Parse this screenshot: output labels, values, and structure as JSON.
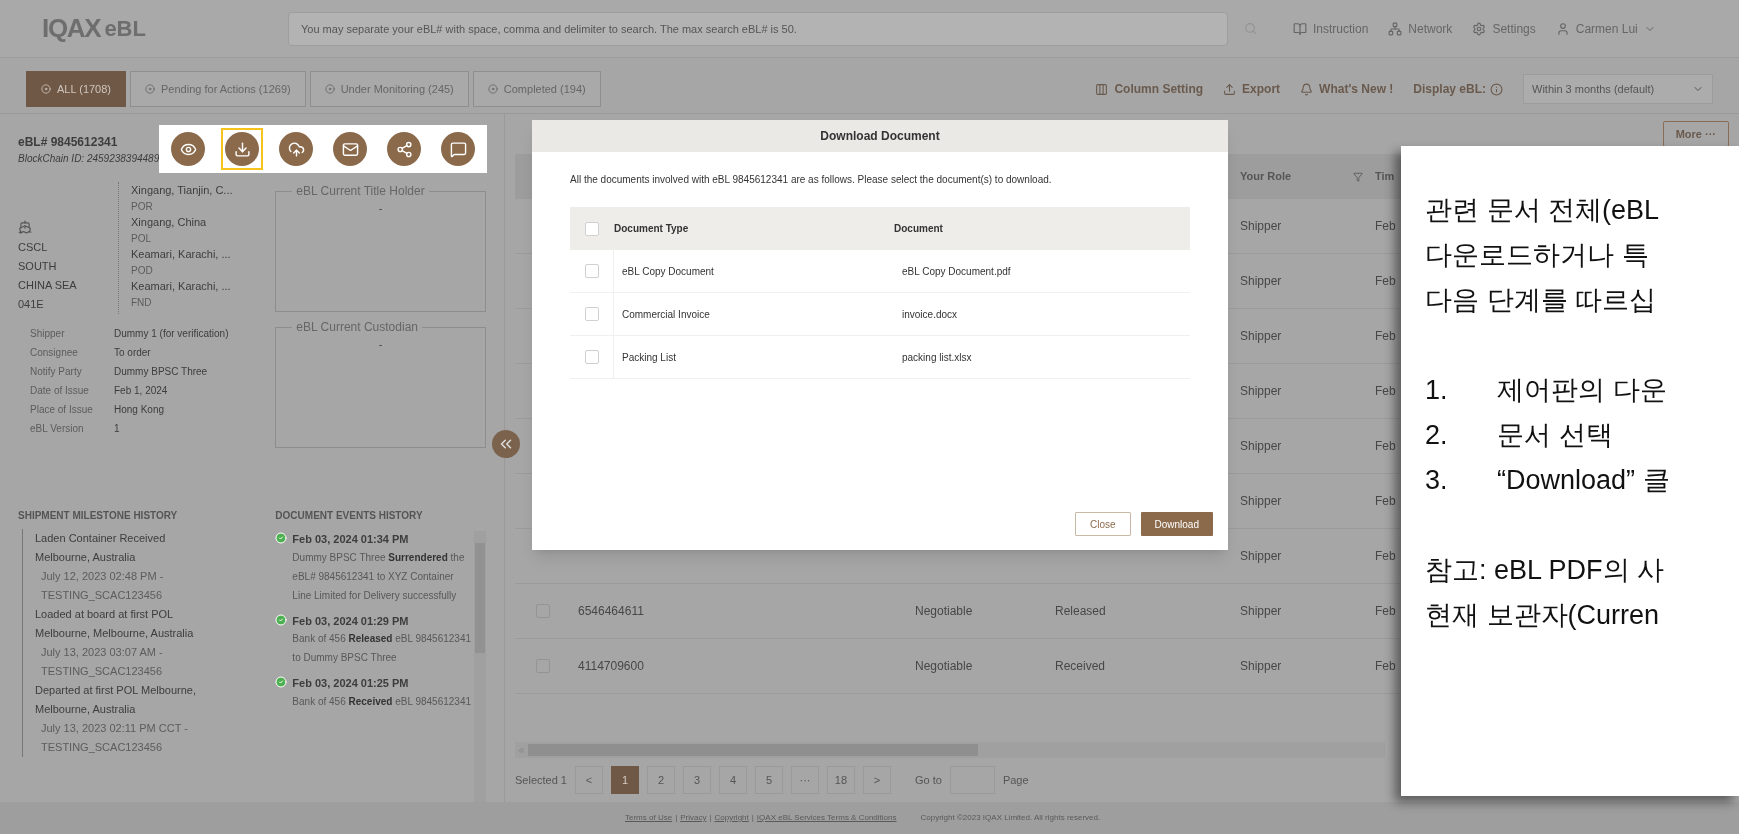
{
  "header": {
    "logo": "IQAX",
    "logo_suffix": "eBL",
    "search": {
      "placeholder": "You may separate your eBL# with space, comma and delimiter to search. The max search eBL# is 50."
    },
    "nav": [
      {
        "kind": "instruction",
        "label": "Instruction"
      },
      {
        "kind": "network",
        "label": "Network"
      },
      {
        "kind": "settings",
        "label": "Settings"
      },
      {
        "kind": "user",
        "label": "Carmen Lui"
      }
    ]
  },
  "tabs": [
    {
      "label": "ALL (1708)",
      "selected": true
    },
    {
      "label": "Pending for Actions (1269)",
      "selected": false
    },
    {
      "label": "Under Monitoring (245)",
      "selected": false
    },
    {
      "label": "Completed (194)",
      "selected": false
    }
  ],
  "tools": [
    {
      "kind": "columns",
      "label": "Column Setting"
    },
    {
      "kind": "export",
      "label": "Export"
    },
    {
      "kind": "news",
      "label": "What's New !"
    }
  ],
  "display": {
    "label": "Display eBL:",
    "value": "Within 3 months (default)"
  },
  "detail": {
    "ebl": "eBL# 9845612341",
    "blockchain": "BlockChain ID: 2459238394489",
    "actions": [
      {
        "kind": "view",
        "highlighted": false
      },
      {
        "kind": "download",
        "highlighted": true
      },
      {
        "kind": "upload",
        "highlighted": false
      },
      {
        "kind": "mail",
        "highlighted": false
      },
      {
        "kind": "share",
        "highlighted": false
      },
      {
        "kind": "comment",
        "highlighted": false
      }
    ],
    "vessel": "CSCL SOUTH CHINA SEA 041E",
    "route": [
      {
        "place": "Xingang, Tianjin, C...",
        "code": "POR"
      },
      {
        "place": "Xingang, China",
        "code": "POL"
      },
      {
        "place": "Keamari, Karachi, ...",
        "code": "POD"
      },
      {
        "place": "Keamari, Karachi, ...",
        "code": "FND"
      }
    ],
    "parties": [
      {
        "label": "Shipper",
        "value": "Dummy 1 (for verification)"
      },
      {
        "label": "Consignee",
        "value": "To order"
      },
      {
        "label": "Notify Party",
        "value": "Dummy BPSC Three"
      },
      {
        "label": "Date of Issue",
        "value": "Feb 1, 2024"
      },
      {
        "label": "Place of Issue",
        "value": "Hong Kong"
      },
      {
        "label": "eBL Version",
        "value": "1"
      }
    ],
    "title_holder": {
      "legend": "eBL Current Title Holder",
      "value": "-"
    },
    "custodian": {
      "legend": "eBL Current Custodian",
      "value": "-"
    },
    "milestones": {
      "title": "SHIPMENT MILESTONE HISTORY",
      "items": [
        {
          "event": "Laden Container Received",
          "location": "Melbourne, Australia",
          "time": "July 12, 2023 02:48 PM - TESTING_SCAC123456"
        },
        {
          "event": "Loaded at board at first POL",
          "location": "Melbourne, Melbourne, Australia",
          "time": "July 13, 2023 03:07 AM - TESTING_SCAC123456"
        },
        {
          "event": "Departed at first POL Melbourne,",
          "location": "Melbourne, Australia",
          "time": "July 13, 2023 02:11 PM CCT - TESTING_SCAC123456"
        }
      ]
    },
    "events": {
      "title": "DOCUMENT EVENTS HISTORY",
      "items": [
        {
          "time": "Feb 03, 2024 01:34 PM",
          "text": "Dummy BPSC Three **Surrendered** the eBL# 9845612341 to XYZ Container Line Limited for Delivery successfully"
        },
        {
          "time": "Feb 03, 2024 01:29 PM",
          "text": "Bank of 456 **Released** eBL 9845612341 to Dummy BPSC Three"
        },
        {
          "time": "Feb 03, 2024 01:25 PM",
          "text": "Bank of 456 **Received** eBL 9845612341"
        }
      ]
    }
  },
  "table": {
    "more": "More ···",
    "columns": [
      {
        "label": "Your Role",
        "filter": true
      },
      {
        "label": "Tim",
        "filter": false
      }
    ],
    "rows": [
      {
        "role": "Shipper",
        "time": "Feb"
      },
      {
        "role": "Shipper",
        "time": "Feb"
      },
      {
        "role": "Shipper",
        "time": "Feb"
      },
      {
        "role": "Shipper",
        "time": "Feb"
      },
      {
        "role": "Shipper",
        "time": "Feb"
      },
      {
        "role": "Shipper",
        "time": "Feb"
      },
      {
        "role": "Shipper",
        "time": "Feb"
      },
      {
        "checked": false,
        "ebl": "6546464611",
        "type": "Negotiable",
        "status": "Released",
        "role": "Shipper",
        "time": "Feb"
      },
      {
        "checked": false,
        "ebl": "4114709600",
        "type": "Negotiable",
        "status": "Received",
        "role": "Shipper",
        "time": "Feb"
      }
    ]
  },
  "pagination": {
    "selected_label": "Selected 1",
    "prev": "<",
    "next": ">",
    "pages": [
      {
        "label": "1",
        "selected": true
      },
      {
        "label": "2",
        "selected": false
      },
      {
        "label": "3",
        "selected": false
      },
      {
        "label": "4",
        "selected": false
      },
      {
        "label": "5",
        "selected": false
      },
      {
        "label": "···",
        "selected": false
      },
      {
        "label": "18",
        "selected": false
      }
    ],
    "goto": "Go to",
    "page": "Page"
  },
  "footer": {
    "links": [
      "Terms of Use",
      "Privacy",
      "Copyright",
      "IQAX eBL Services Terms & Conditions"
    ],
    "separator": "|",
    "copyright": "Copyright ©2023 IQAX Limited. All rights reserved."
  },
  "modal": {
    "title": "Download Document",
    "intro": "All the documents involved with eBL 9845612341 are as follows. Please select the document(s) to download.",
    "select_all": {
      "checked": false
    },
    "columns": [
      "Document Type",
      "Document"
    ],
    "rows": [
      {
        "type": "eBL Copy Document",
        "file": "eBL Copy Document.pdf",
        "checked": false
      },
      {
        "type": "Commercial Invoice",
        "file": "invoice.docx",
        "checked": false
      },
      {
        "type": "Packing List",
        "file": "packing list.xlsx",
        "checked": false
      }
    ],
    "buttons": [
      {
        "kind": "secondary",
        "label": "Close"
      },
      {
        "kind": "primary",
        "label": "Download"
      }
    ]
  },
  "note_card": {
    "intro": [
      "관련 문서 전체(eBL",
      "다운로드하거나 특",
      "다음 단계를 따르십"
    ],
    "steps": [
      {
        "number": "1.",
        "text": "제어판의 다운"
      },
      {
        "number": "2.",
        "text": "문서 선택"
      },
      {
        "number": "3.",
        "text": "“Download” 클"
      }
    ],
    "note": [
      "참고: eBL PDF의 사",
      "현재 보관자(Curren"
    ]
  }
}
